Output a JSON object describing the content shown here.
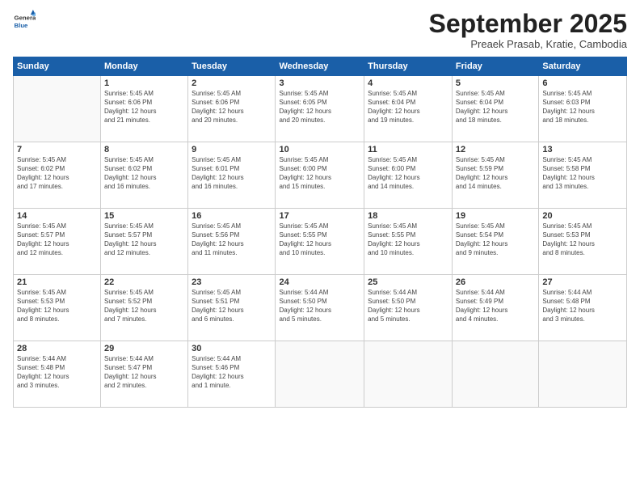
{
  "logo": {
    "line1": "General",
    "line2": "Blue"
  },
  "title": "September 2025",
  "subtitle": "Preaek Prasab, Kratie, Cambodia",
  "days_of_week": [
    "Sunday",
    "Monday",
    "Tuesday",
    "Wednesday",
    "Thursday",
    "Friday",
    "Saturday"
  ],
  "weeks": [
    [
      {
        "day": "",
        "info": ""
      },
      {
        "day": "1",
        "info": "Sunrise: 5:45 AM\nSunset: 6:06 PM\nDaylight: 12 hours\nand 21 minutes."
      },
      {
        "day": "2",
        "info": "Sunrise: 5:45 AM\nSunset: 6:06 PM\nDaylight: 12 hours\nand 20 minutes."
      },
      {
        "day": "3",
        "info": "Sunrise: 5:45 AM\nSunset: 6:05 PM\nDaylight: 12 hours\nand 20 minutes."
      },
      {
        "day": "4",
        "info": "Sunrise: 5:45 AM\nSunset: 6:04 PM\nDaylight: 12 hours\nand 19 minutes."
      },
      {
        "day": "5",
        "info": "Sunrise: 5:45 AM\nSunset: 6:04 PM\nDaylight: 12 hours\nand 18 minutes."
      },
      {
        "day": "6",
        "info": "Sunrise: 5:45 AM\nSunset: 6:03 PM\nDaylight: 12 hours\nand 18 minutes."
      }
    ],
    [
      {
        "day": "7",
        "info": "Sunrise: 5:45 AM\nSunset: 6:02 PM\nDaylight: 12 hours\nand 17 minutes."
      },
      {
        "day": "8",
        "info": "Sunrise: 5:45 AM\nSunset: 6:02 PM\nDaylight: 12 hours\nand 16 minutes."
      },
      {
        "day": "9",
        "info": "Sunrise: 5:45 AM\nSunset: 6:01 PM\nDaylight: 12 hours\nand 16 minutes."
      },
      {
        "day": "10",
        "info": "Sunrise: 5:45 AM\nSunset: 6:00 PM\nDaylight: 12 hours\nand 15 minutes."
      },
      {
        "day": "11",
        "info": "Sunrise: 5:45 AM\nSunset: 6:00 PM\nDaylight: 12 hours\nand 14 minutes."
      },
      {
        "day": "12",
        "info": "Sunrise: 5:45 AM\nSunset: 5:59 PM\nDaylight: 12 hours\nand 14 minutes."
      },
      {
        "day": "13",
        "info": "Sunrise: 5:45 AM\nSunset: 5:58 PM\nDaylight: 12 hours\nand 13 minutes."
      }
    ],
    [
      {
        "day": "14",
        "info": "Sunrise: 5:45 AM\nSunset: 5:57 PM\nDaylight: 12 hours\nand 12 minutes."
      },
      {
        "day": "15",
        "info": "Sunrise: 5:45 AM\nSunset: 5:57 PM\nDaylight: 12 hours\nand 12 minutes."
      },
      {
        "day": "16",
        "info": "Sunrise: 5:45 AM\nSunset: 5:56 PM\nDaylight: 12 hours\nand 11 minutes."
      },
      {
        "day": "17",
        "info": "Sunrise: 5:45 AM\nSunset: 5:55 PM\nDaylight: 12 hours\nand 10 minutes."
      },
      {
        "day": "18",
        "info": "Sunrise: 5:45 AM\nSunset: 5:55 PM\nDaylight: 12 hours\nand 10 minutes."
      },
      {
        "day": "19",
        "info": "Sunrise: 5:45 AM\nSunset: 5:54 PM\nDaylight: 12 hours\nand 9 minutes."
      },
      {
        "day": "20",
        "info": "Sunrise: 5:45 AM\nSunset: 5:53 PM\nDaylight: 12 hours\nand 8 minutes."
      }
    ],
    [
      {
        "day": "21",
        "info": "Sunrise: 5:45 AM\nSunset: 5:53 PM\nDaylight: 12 hours\nand 8 minutes."
      },
      {
        "day": "22",
        "info": "Sunrise: 5:45 AM\nSunset: 5:52 PM\nDaylight: 12 hours\nand 7 minutes."
      },
      {
        "day": "23",
        "info": "Sunrise: 5:45 AM\nSunset: 5:51 PM\nDaylight: 12 hours\nand 6 minutes."
      },
      {
        "day": "24",
        "info": "Sunrise: 5:44 AM\nSunset: 5:50 PM\nDaylight: 12 hours\nand 5 minutes."
      },
      {
        "day": "25",
        "info": "Sunrise: 5:44 AM\nSunset: 5:50 PM\nDaylight: 12 hours\nand 5 minutes."
      },
      {
        "day": "26",
        "info": "Sunrise: 5:44 AM\nSunset: 5:49 PM\nDaylight: 12 hours\nand 4 minutes."
      },
      {
        "day": "27",
        "info": "Sunrise: 5:44 AM\nSunset: 5:48 PM\nDaylight: 12 hours\nand 3 minutes."
      }
    ],
    [
      {
        "day": "28",
        "info": "Sunrise: 5:44 AM\nSunset: 5:48 PM\nDaylight: 12 hours\nand 3 minutes."
      },
      {
        "day": "29",
        "info": "Sunrise: 5:44 AM\nSunset: 5:47 PM\nDaylight: 12 hours\nand 2 minutes."
      },
      {
        "day": "30",
        "info": "Sunrise: 5:44 AM\nSunset: 5:46 PM\nDaylight: 12 hours\nand 1 minute."
      },
      {
        "day": "",
        "info": ""
      },
      {
        "day": "",
        "info": ""
      },
      {
        "day": "",
        "info": ""
      },
      {
        "day": "",
        "info": ""
      }
    ]
  ]
}
